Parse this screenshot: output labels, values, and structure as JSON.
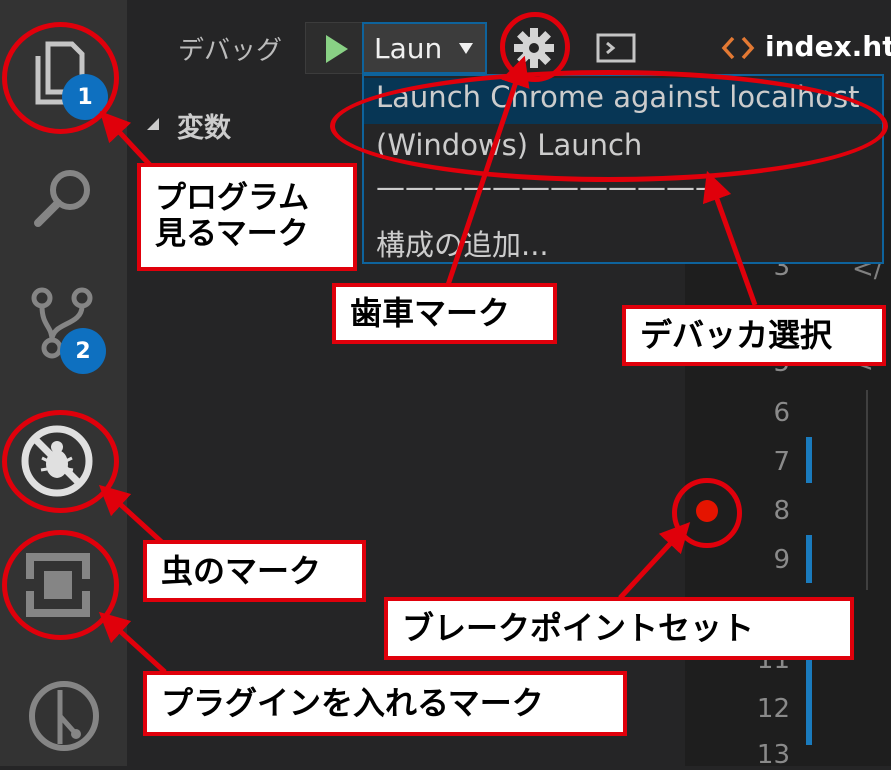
{
  "toolbar": {
    "debug_label": "デバッグ",
    "config_select": "Laun",
    "tab_title": "index.htm"
  },
  "sidepanel": {
    "variables_label": "変数"
  },
  "dropdown": {
    "options": [
      "Launch Chrome against localhost",
      "(Windows) Launch",
      "————————————",
      "構成の追加..."
    ]
  },
  "activity_bar": {
    "explorer_badge": "1",
    "scm_badge": "2"
  },
  "editor": {
    "line_numbers": [
      "3",
      "5",
      "6",
      "7",
      "8",
      "9",
      "11",
      "12",
      "13"
    ]
  },
  "annotations": {
    "program_view": "プログラム\n見るマーク",
    "gear": "歯車マーク",
    "debugger_select": "デバッカ選択",
    "bug": "虫のマーク",
    "breakpoint": "ブレークポイントセット",
    "plugin": "プラグインを入れるマーク"
  },
  "colors": {
    "annotation_red": "#e0000b",
    "breakpoint_red": "#e51400",
    "badge_blue": "#0e70c0",
    "run_green": "#89d185"
  }
}
